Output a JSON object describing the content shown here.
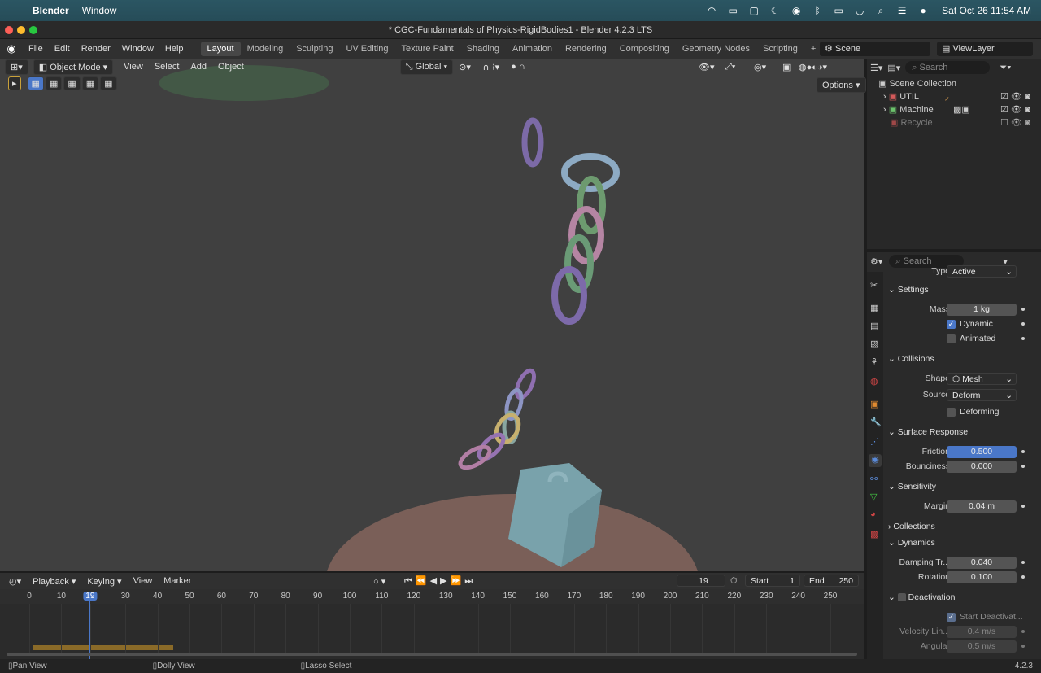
{
  "menubar": {
    "app": "Blender",
    "items": [
      "Window"
    ],
    "clock": "Sat Oct 26  11:54 AM"
  },
  "window": {
    "title": "* CGC-Fundamentals of Physics-RigidBodies1 - Blender 4.2.3 LTS"
  },
  "topbar": {
    "menus": [
      "File",
      "Edit",
      "Render",
      "Window",
      "Help"
    ],
    "workspaces": [
      "Layout",
      "Modeling",
      "Sculpting",
      "UV Editing",
      "Texture Paint",
      "Shading",
      "Animation",
      "Rendering",
      "Compositing",
      "Geometry Nodes",
      "Scripting"
    ],
    "add_workspace": "+",
    "scene": "Scene",
    "view_layer": "ViewLayer"
  },
  "viewport": {
    "mode": "Object Mode",
    "menus": [
      "View",
      "Select",
      "Add",
      "Object"
    ],
    "orientation": "Global",
    "options": "Options"
  },
  "outliner": {
    "search_placeholder": "Search",
    "root": "Scene Collection",
    "items": [
      {
        "name": "UTIL",
        "enabled": true
      },
      {
        "name": "Machine",
        "enabled": true
      },
      {
        "name": "Recycle",
        "enabled": false
      }
    ]
  },
  "properties": {
    "search_placeholder": "Search",
    "type_label": "Type",
    "type_value": "Active",
    "settings": {
      "header": "Settings",
      "mass_label": "Mass",
      "mass": "1 kg",
      "dynamic": "Dynamic",
      "animated": "Animated"
    },
    "collisions": {
      "header": "Collisions",
      "shape_label": "Shape",
      "shape": "Mesh",
      "source_label": "Source",
      "source": "Deform",
      "deforming": "Deforming"
    },
    "surface": {
      "header": "Surface Response",
      "friction_label": "Friction",
      "friction": "0.500",
      "bounciness_label": "Bounciness",
      "bounciness": "0.000"
    },
    "sensitivity": {
      "header": "Sensitivity",
      "margin_label": "Margin",
      "margin": "0.04 m"
    },
    "collections_header": "Collections",
    "dynamics": {
      "header": "Dynamics",
      "damping_label": "Damping Tr...",
      "damping": "0.040",
      "rotation_label": "Rotation",
      "rotation": "0.100"
    },
    "deactivation": {
      "header": "Deactivation",
      "start": "Start Deactivat...",
      "velocity_label": "Velocity Lin...",
      "velocity": "0.4 m/s",
      "angular_label": "Angular",
      "angular": "0.5 m/s"
    }
  },
  "timeline": {
    "menus": [
      "Playback",
      "Keying",
      "View",
      "Marker"
    ],
    "current_frame": "19",
    "start_label": "Start",
    "start": "1",
    "end_label": "End",
    "end": "250",
    "ticks": [
      "0",
      "10",
      "19",
      "30",
      "40",
      "50",
      "60",
      "70",
      "80",
      "90",
      "100",
      "110",
      "120",
      "130",
      "140",
      "150",
      "160",
      "170",
      "180",
      "190",
      "200",
      "210",
      "220",
      "230",
      "240",
      "250"
    ]
  },
  "statusbar": {
    "pan": "Pan View",
    "dolly": "Dolly View",
    "lasso": "Lasso Select",
    "version": "4.2.3"
  }
}
